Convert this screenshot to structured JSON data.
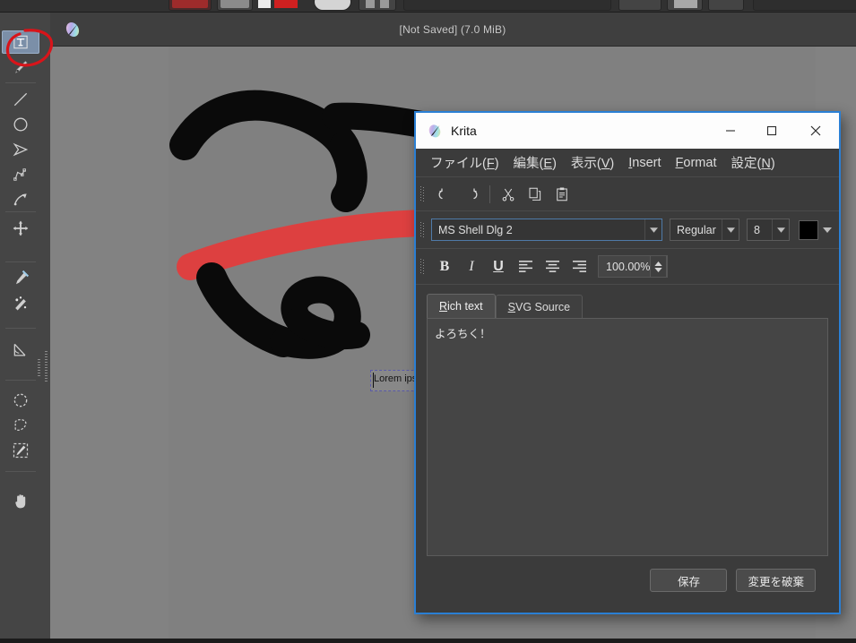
{
  "app": {
    "title_bar": "[Not Saved]  (7.0 MiB)",
    "logo_icon": "krita-logo-icon"
  },
  "toolbox": {
    "items": [
      {
        "name": "text-tool",
        "icon": "text-tool-icon",
        "active": true
      },
      {
        "name": "calligraphy-tool",
        "icon": "calligraphy-pen-icon",
        "active": false
      },
      {
        "name": "line-tool",
        "icon": "line-icon",
        "active": false
      },
      {
        "name": "ellipse-tool",
        "icon": "ellipse-icon",
        "active": false
      },
      {
        "name": "polygon-tool",
        "icon": "polygon-icon",
        "active": false
      },
      {
        "name": "polyline-tool",
        "icon": "polyline-icon",
        "active": false
      },
      {
        "name": "bezier-curve-tool",
        "icon": "bezier-curve-icon",
        "active": false
      },
      {
        "name": "move-tool",
        "icon": "move-arrows-icon",
        "active": false
      },
      {
        "name": "color-sampler-tool",
        "icon": "eyedropper-icon",
        "active": false
      },
      {
        "name": "colorize-mask-tool",
        "icon": "colorize-mask-icon",
        "active": false
      },
      {
        "name": "measure-tool",
        "icon": "measure-angle-icon",
        "active": false
      },
      {
        "name": "elliptical-selection-tool",
        "icon": "elliptical-selection-icon",
        "active": false
      },
      {
        "name": "polygonal-selection-tool",
        "icon": "polygonal-selection-icon",
        "active": false
      },
      {
        "name": "similar-color-selection-tool",
        "icon": "similar-color-selection-icon",
        "active": false
      },
      {
        "name": "pan-tool",
        "icon": "hand-pan-icon",
        "active": false
      }
    ]
  },
  "canvas": {
    "text_shape": {
      "content": "Lorem ipsum dolor sit amet, co",
      "selected": true
    },
    "artwork_description": "black and red brush strokes"
  },
  "annotation": {
    "shape": "red-ellipse-highlight",
    "color": "#d8141a"
  },
  "dialog": {
    "title": "Krita",
    "logo_icon": "krita-logo-icon",
    "window_buttons": [
      {
        "name": "minimize-button",
        "glyph": "─"
      },
      {
        "name": "maximize-button",
        "glyph": "☐"
      },
      {
        "name": "close-button",
        "glyph": "✕"
      }
    ],
    "menus": [
      {
        "name": "menu-file",
        "pre": "ファイル(",
        "key": "F",
        "post": ")"
      },
      {
        "name": "menu-edit",
        "pre": "編集(",
        "key": "E",
        "post": ")"
      },
      {
        "name": "menu-view",
        "pre": "表示(",
        "key": "V",
        "post": ")"
      },
      {
        "name": "menu-insert",
        "pre": "",
        "key": "I",
        "post": "nsert"
      },
      {
        "name": "menu-format",
        "pre": "",
        "key": "F",
        "post": "ormat"
      },
      {
        "name": "menu-settings",
        "pre": "設定(",
        "key": "N",
        "post": ")"
      }
    ],
    "toolbar": [
      {
        "name": "undo-button",
        "icon": "undo-arrow-icon"
      },
      {
        "name": "redo-button",
        "icon": "redo-arrow-icon"
      },
      {
        "name": "cut-button",
        "icon": "scissors-icon"
      },
      {
        "name": "copy-button",
        "icon": "copy-pages-icon"
      },
      {
        "name": "paste-button",
        "icon": "clipboard-paste-icon"
      }
    ],
    "font": {
      "family": "MS Shell Dlg 2",
      "style": "Regular",
      "size": "8",
      "color": "#000000",
      "color_swatch_name": "text-color-swatch"
    },
    "format": {
      "bold_label": "B",
      "italic_label": "I",
      "underline_label": "U",
      "align_left_icon": "align-left-icon",
      "align_center_icon": "align-center-icon",
      "align_right_icon": "align-right-icon",
      "line_height_value": "100.00%"
    },
    "tabs": [
      {
        "name": "tab-rich-text",
        "key": "R",
        "rest": "ich text",
        "active": true
      },
      {
        "name": "tab-svg-source",
        "key": "S",
        "rest": "VG Source",
        "active": false
      }
    ],
    "editor": {
      "content": "よろちく！"
    },
    "buttons": [
      {
        "name": "save-button",
        "label": "保存"
      },
      {
        "name": "discard-changes-button",
        "label": "変更を破棄"
      }
    ]
  },
  "colors": {
    "dialog_border": "#2a7fd4",
    "canvas_bg": "#808080",
    "stroke_black": "#0a0a0a",
    "stroke_red": "#dd4040"
  }
}
